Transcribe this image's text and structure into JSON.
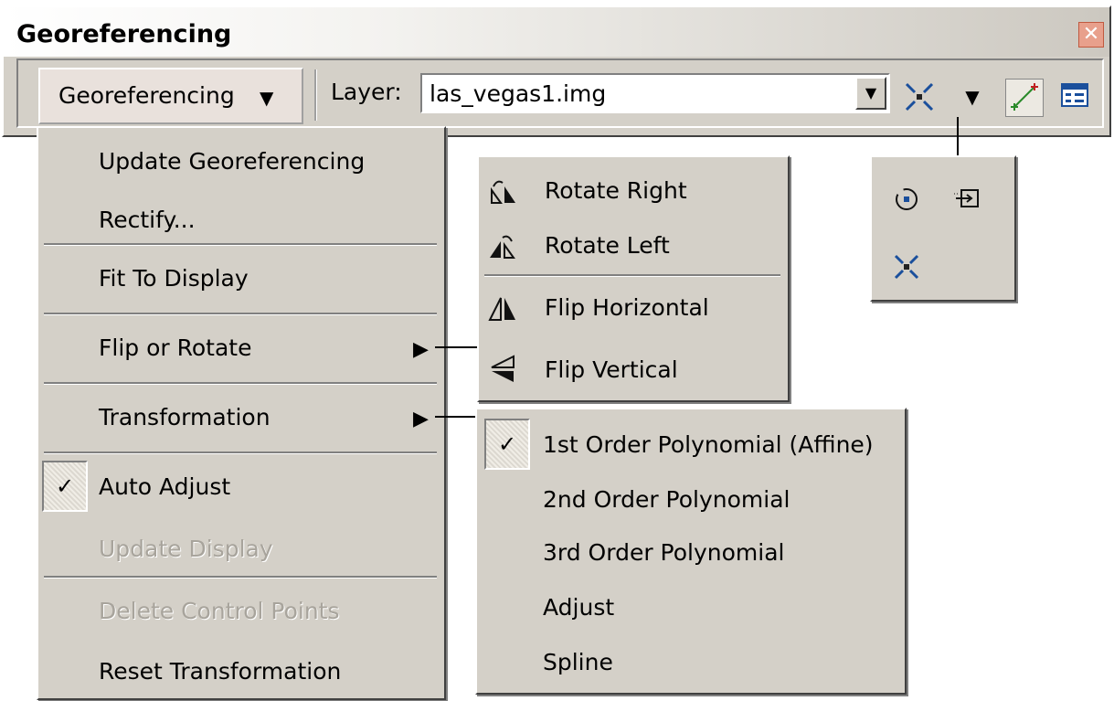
{
  "window": {
    "title": "Georeferencing",
    "close_label": "✕"
  },
  "toolbar": {
    "georef_button": "Georeferencing",
    "georef_arrow": "▼",
    "layer_label": "Layer:",
    "layer_value": "las_vegas1.img",
    "combo_arrow": "▼",
    "dropdown_arrow": "▼",
    "icons": [
      "fit-to-display-icon",
      "add-control-points-icon",
      "view-link-table-icon"
    ]
  },
  "main_menu": {
    "items": [
      {
        "label": "Update Georeferencing",
        "enabled": true
      },
      {
        "label": "Rectify...",
        "enabled": true
      },
      {
        "label": "Fit To Display",
        "enabled": true
      },
      {
        "label": "Flip or Rotate",
        "enabled": true,
        "submenu": true
      },
      {
        "label": "Transformation",
        "enabled": true,
        "submenu": true
      },
      {
        "label": "Auto Adjust",
        "enabled": true,
        "checked": true
      },
      {
        "label": "Update Display",
        "enabled": false
      },
      {
        "label": "Delete Control Points",
        "enabled": false
      },
      {
        "label": "Reset Transformation",
        "enabled": true
      }
    ],
    "check_glyph": "✓",
    "submenu_glyph": "▶"
  },
  "flip_menu": {
    "items": [
      {
        "label": "Rotate Right",
        "icon": "rotate-right-icon"
      },
      {
        "label": "Rotate Left",
        "icon": "rotate-left-icon"
      },
      {
        "label": "Flip Horizontal",
        "icon": "flip-horizontal-icon"
      },
      {
        "label": "Flip Vertical",
        "icon": "flip-vertical-icon"
      }
    ]
  },
  "transform_menu": {
    "items": [
      {
        "label": "1st Order Polynomial (Affine)",
        "checked": true
      },
      {
        "label": "2nd Order Polynomial"
      },
      {
        "label": "3rd Order Polynomial"
      },
      {
        "label": "Adjust"
      },
      {
        "label": "Spline"
      }
    ],
    "check_glyph": "✓"
  },
  "tool_palette": {
    "icons": [
      "rotate-tool-icon",
      "shift-tool-icon",
      "fit-to-display-icon"
    ]
  }
}
